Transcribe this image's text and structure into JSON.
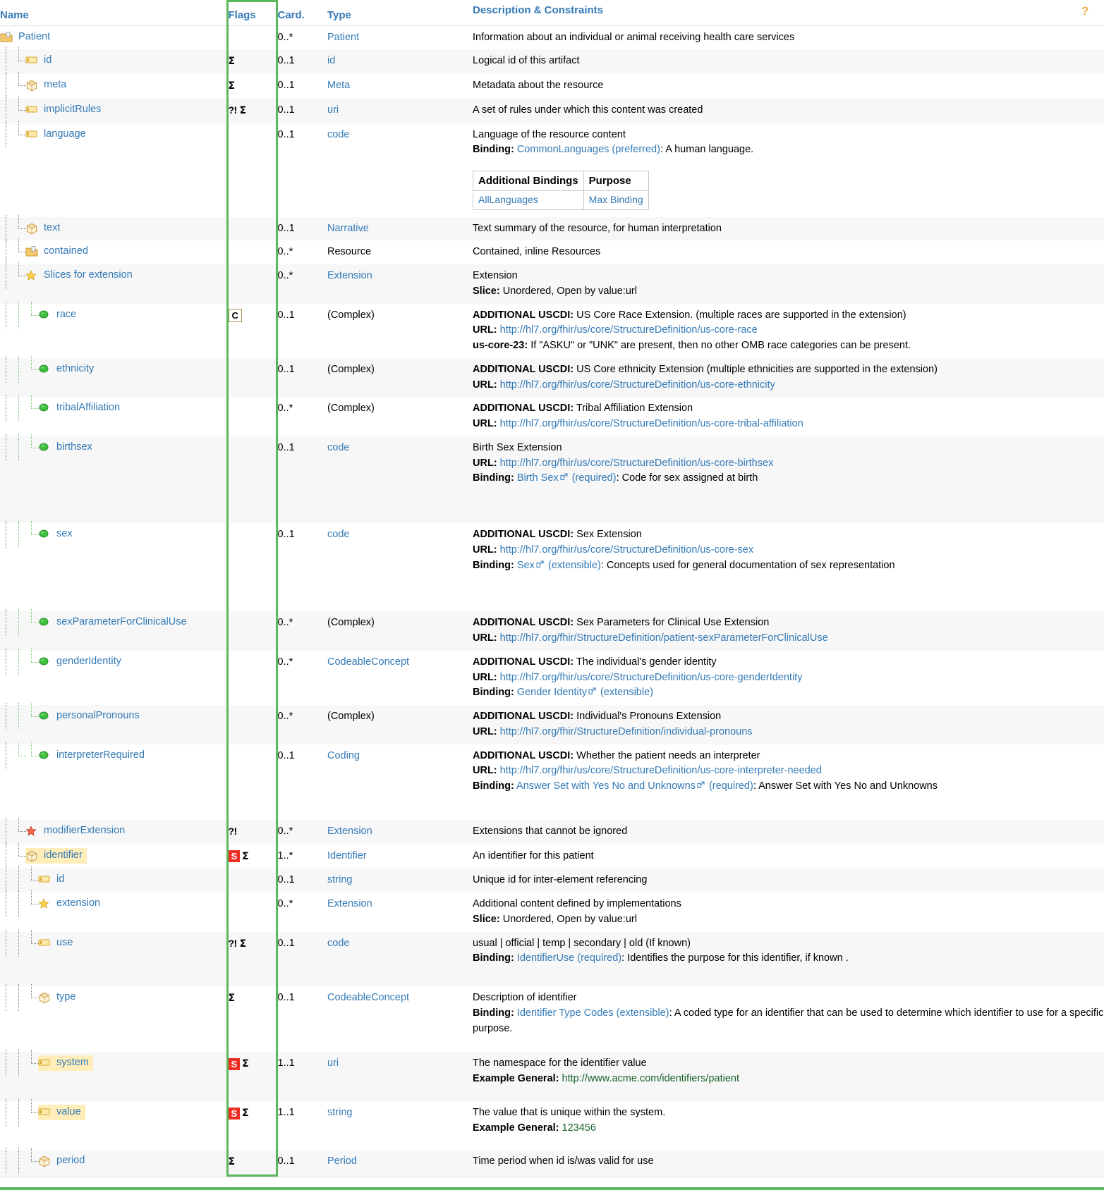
{
  "colors": {
    "link": "#337ab7",
    "highlight_row": "#ffeeba",
    "green_border": "#5cb85c",
    "s_badge": "#ee2d24",
    "example_green": "#17632b"
  },
  "header": {
    "name": "Name",
    "flags": "Flags",
    "card": "Card.",
    "type": "Type",
    "description": "Description & Constraints",
    "help_icon": "help-question-icon"
  },
  "additional_bindings_table": {
    "col1": "Additional Bindings",
    "col2": "Purpose",
    "row1col1": "AllLanguages",
    "row1col2": "Max Binding"
  },
  "rows": [
    {
      "name": "Patient",
      "icon": "resource-icon",
      "flags": "",
      "card": "0..*",
      "type": "Patient",
      "desc": "Information about an individual or animal receiving health care services"
    },
    {
      "name": "id",
      "icon": "primitive-icon",
      "flags": "Σ",
      "card": "0..1",
      "type": "id",
      "desc": "Logical id of this artifact"
    },
    {
      "name": "meta",
      "icon": "datatype-icon",
      "flags": "Σ",
      "card": "0..1",
      "type": "Meta",
      "desc": "Metadata about the resource"
    },
    {
      "name": "implicitRules",
      "icon": "primitive-icon",
      "flags": "?! Σ",
      "card": "0..1",
      "type": "uri",
      "desc": "A set of rules under which this content was created"
    },
    {
      "name": "language",
      "icon": "primitive-icon",
      "flags": "",
      "card": "0..1",
      "type": "code",
      "desc": "Language of the resource content",
      "binding_label": "Binding:",
      "binding_link": "CommonLanguages",
      "binding_strength": "(preferred)",
      "binding_tail": ": A human language."
    },
    {
      "name": "text",
      "icon": "datatype-icon",
      "flags": "",
      "card": "0..1",
      "type": "Narrative",
      "desc": "Text summary of the resource, for human interpretation"
    },
    {
      "name": "contained",
      "icon": "resource-icon",
      "flags": "",
      "card": "0..*",
      "type": "Resource",
      "type_plain": true,
      "desc": "Contained, inline Resources"
    },
    {
      "name": "Slices for extension",
      "icon": "star-icon",
      "flags": "",
      "card": "0..*",
      "type": "Extension",
      "desc": "Extension",
      "slice_label": "Slice:",
      "slice_text": "Unordered, Open by value:url"
    },
    {
      "name": "race",
      "icon": "slice-icon",
      "flags": "C",
      "card": "0..1",
      "type": "(Complex)",
      "type_plain": true,
      "uscdi_label": "ADDITIONAL USCDI:",
      "uscdi_text": "US Core Race Extension. (multiple races are supported in the extension)",
      "url_label": "URL:",
      "url": "http://hl7.org/fhir/us/core/StructureDefinition/us-core-race",
      "constraint_label": "us-core-23:",
      "constraint_text": "If \"ASKU\" or \"UNK\" are present, then no other OMB race categories can be present."
    },
    {
      "name": "ethnicity",
      "icon": "slice-icon",
      "flags": "",
      "card": "0..1",
      "type": "(Complex)",
      "type_plain": true,
      "uscdi_label": "ADDITIONAL USCDI:",
      "uscdi_text": "US Core ethnicity Extension (multiple ethnicities are supported in the extension)",
      "url_label": "URL:",
      "url": "http://hl7.org/fhir/us/core/StructureDefinition/us-core-ethnicity"
    },
    {
      "name": "tribalAffiliation",
      "icon": "slice-icon",
      "flags": "",
      "card": "0..*",
      "type": "(Complex)",
      "type_plain": true,
      "uscdi_label": "ADDITIONAL USCDI:",
      "uscdi_text": "Tribal Affiliation Extension",
      "url_label": "URL:",
      "url": "http://hl7.org/fhir/us/core/StructureDefinition/us-core-tribal-affiliation"
    },
    {
      "name": "birthsex",
      "icon": "slice-icon",
      "flags": "",
      "card": "0..1",
      "type": "code",
      "desc": "Birth Sex Extension",
      "url_label": "URL:",
      "url": "http://hl7.org/fhir/us/core/StructureDefinition/us-core-birthsex",
      "binding_label": "Binding:",
      "binding_link": "Birth Sex",
      "binding_external": true,
      "binding_strength": "(required)",
      "binding_tail": ": Code for sex assigned at birth"
    },
    {
      "name": "sex",
      "icon": "slice-icon",
      "flags": "",
      "card": "0..1",
      "type": "code",
      "uscdi_label": "ADDITIONAL USCDI:",
      "uscdi_text": "Sex Extension",
      "url_label": "URL:",
      "url": "http://hl7.org/fhir/us/core/StructureDefinition/us-core-sex",
      "binding_label": "Binding:",
      "binding_link": "Sex",
      "binding_external": true,
      "binding_strength": "(extensible)",
      "binding_tail": ": Concepts used for general documentation of sex representation"
    },
    {
      "name": "sexParameterForClinicalUse",
      "icon": "slice-icon",
      "flags": "",
      "card": "0..*",
      "type": "(Complex)",
      "type_plain": true,
      "uscdi_label": "ADDITIONAL USCDI:",
      "uscdi_text": "Sex Parameters for Clinical Use Extension",
      "url_label": "URL:",
      "url": "http://hl7.org/fhir/StructureDefinition/patient-sexParameterForClinicalUse"
    },
    {
      "name": "genderIdentity",
      "icon": "slice-icon",
      "flags": "",
      "card": "0..*",
      "type": "CodeableConcept",
      "uscdi_label": "ADDITIONAL USCDI:",
      "uscdi_text": "The individual's gender identity",
      "url_label": "URL:",
      "url": "http://hl7.org/fhir/us/core/StructureDefinition/us-core-genderIdentity",
      "binding_label": "Binding:",
      "binding_link": "Gender Identity",
      "binding_external": true,
      "binding_strength": "(extensible)",
      "binding_tail": ""
    },
    {
      "name": "personalPronouns",
      "icon": "slice-icon",
      "flags": "",
      "card": "0..*",
      "type": "(Complex)",
      "type_plain": true,
      "uscdi_label": "ADDITIONAL USCDI:",
      "uscdi_text": "Individual's Pronouns Extension",
      "url_label": "URL:",
      "url": "http://hl7.org/fhir/StructureDefinition/individual-pronouns"
    },
    {
      "name": "interpreterRequired",
      "icon": "slice-icon",
      "flags": "",
      "card": "0..1",
      "type": "Coding",
      "uscdi_label": "ADDITIONAL USCDI:",
      "uscdi_text": "Whether the patient needs an interpreter",
      "url_label": "URL:",
      "url": "http://hl7.org/fhir/us/core/StructureDefinition/us-core-interpreter-needed",
      "binding_label": "Binding:",
      "binding_link": "Answer Set with Yes No and Unknowns",
      "binding_external": true,
      "binding_strength": "(required)",
      "binding_tail": ": Answer Set with Yes No and Unknowns"
    },
    {
      "name": "modifierExtension",
      "icon": "star-red-icon",
      "flags": "?!",
      "card": "0..*",
      "type": "Extension",
      "desc": "Extensions that cannot be ignored"
    },
    {
      "name": "identifier",
      "icon": "datatype-icon",
      "flags": "S Σ",
      "card": "1..*",
      "type": "Identifier",
      "desc": "An identifier for this patient",
      "highlight": true
    },
    {
      "name": "id",
      "icon": "primitive-icon",
      "flags": "",
      "card": "0..1",
      "type": "string",
      "desc": "Unique id for inter-element referencing"
    },
    {
      "name": "extension",
      "icon": "star-icon",
      "flags": "",
      "card": "0..*",
      "type": "Extension",
      "desc": "Additional content defined by implementations",
      "slice_label": "Slice:",
      "slice_text": "Unordered, Open by value:url"
    },
    {
      "name": "use",
      "icon": "primitive-icon",
      "flags": "?! Σ",
      "card": "0..1",
      "type": "code",
      "desc": "usual | official | temp | secondary | old (If known)",
      "binding_label": "Binding:",
      "binding_link": "IdentifierUse",
      "binding_strength": "(required)",
      "binding_tail": ": Identifies the purpose for this identifier, if known ."
    },
    {
      "name": "type",
      "icon": "datatype-icon",
      "flags": "Σ",
      "card": "0..1",
      "type": "CodeableConcept",
      "desc": "Description of identifier",
      "binding_label": "Binding:",
      "binding_link": "Identifier Type Codes",
      "binding_strength": "(extensible)",
      "binding_tail": ": A coded type for an identifier that can be used to determine which identifier to use for a specific purpose."
    },
    {
      "name": "system",
      "icon": "primitive-icon",
      "flags": "S Σ",
      "card": "1..1",
      "type": "uri",
      "desc": "The namespace for the identifier value",
      "example_label": "Example General:",
      "example_value": "http://www.acme.com/identifiers/patient",
      "highlight": true
    },
    {
      "name": "value",
      "icon": "primitive-icon",
      "flags": "S Σ",
      "card": "1..1",
      "type": "string",
      "desc": "The value that is unique within the system.",
      "example_label": "Example General:",
      "example_value": "123456",
      "highlight": true
    },
    {
      "name": "period",
      "icon": "datatype-icon",
      "flags": "Σ",
      "card": "0..1",
      "type": "Period",
      "desc": "Time period when id is/was valid for use"
    }
  ]
}
